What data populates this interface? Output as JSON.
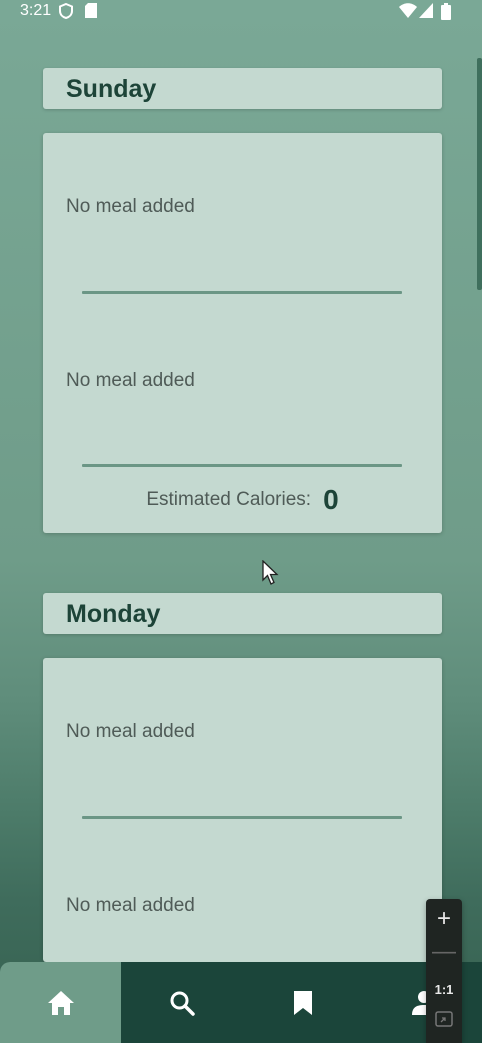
{
  "status_bar": {
    "time": "3:21",
    "icons": [
      "shield-icon",
      "sim-card-icon",
      "wifi-icon",
      "signal-icon",
      "battery-icon"
    ]
  },
  "days": [
    {
      "name": "Sunday",
      "meals": [
        "No meal added",
        "No meal added"
      ],
      "calories_label": "Estimated Calories:",
      "calories_value": "0"
    },
    {
      "name": "Monday",
      "meals": [
        "No meal added",
        "No meal added"
      ]
    }
  ],
  "bottom_nav": {
    "items": [
      {
        "icon": "home-icon",
        "active": true
      },
      {
        "icon": "search-icon",
        "active": false
      },
      {
        "icon": "bookmark-icon",
        "active": false
      },
      {
        "icon": "profile-icon",
        "active": false
      }
    ]
  },
  "zoom_control": {
    "zoom_in": "+",
    "zoom_out": "—",
    "reset": "1:1"
  },
  "colors": {
    "card": "#c4d9d0",
    "title": "#1d4438",
    "divider": "#6b9685",
    "nav_bg": "#1b453a",
    "nav_active": "#6f9c89"
  }
}
